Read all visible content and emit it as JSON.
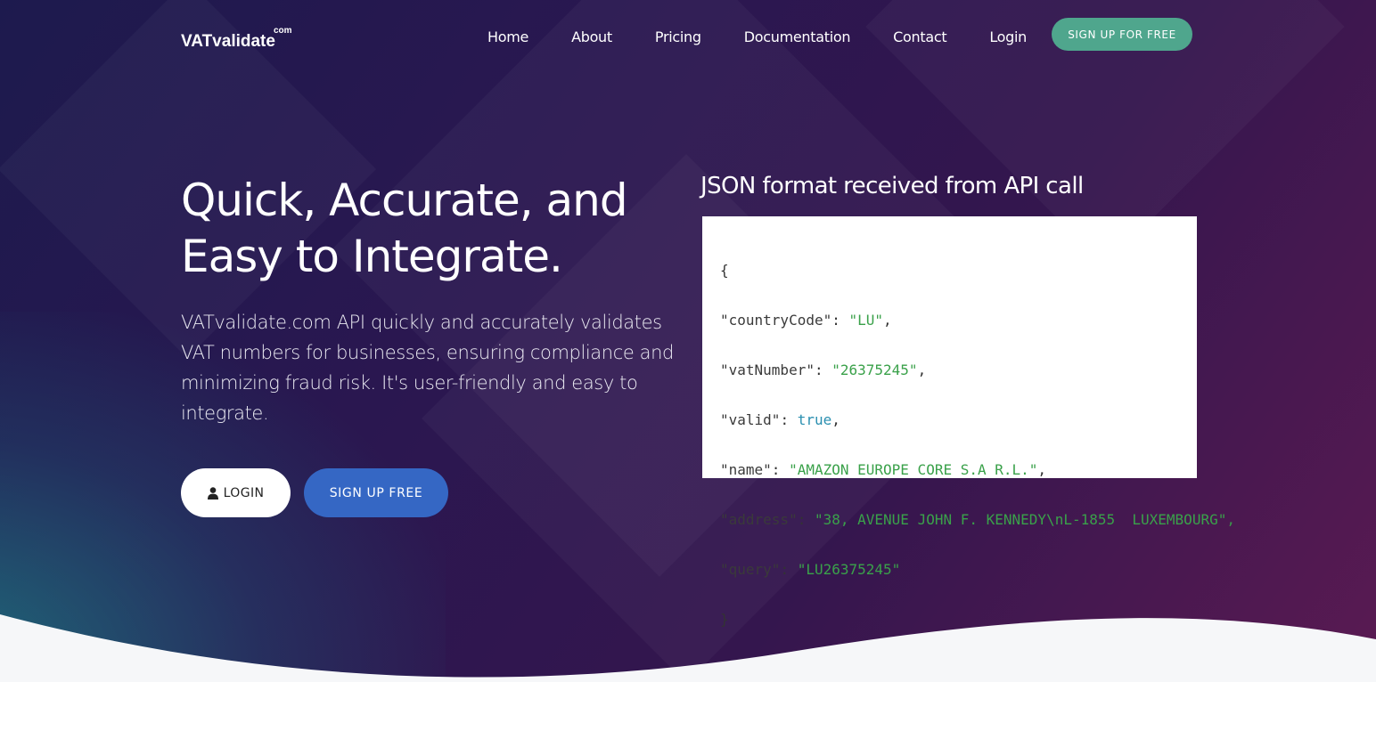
{
  "logo": {
    "name": "VATvalidate",
    "suffix": "com"
  },
  "nav": {
    "items": [
      "Home",
      "About",
      "Pricing",
      "Documentation",
      "Contact",
      "Login"
    ],
    "cta": "SIGN UP FOR FREE"
  },
  "hero": {
    "headline_line1": "Quick, Accurate, and",
    "headline_line2": "Easy to Integrate.",
    "lead": "VATvalidate.com API quickly and accurately validates VAT numbers for businesses, ensuring compliance and minimizing fraud risk. It's user-friendly and easy to integrate.",
    "login_label": "LOGIN",
    "signup_label": "SIGN UP FREE"
  },
  "json_panel": {
    "title": "JSON format received from API call",
    "open_brace": "{",
    "close_brace": "}",
    "fields": [
      {
        "key": "\"countryCode\"",
        "value": "\"LU\"",
        "type": "string",
        "comma": ","
      },
      {
        "key": "\"vatNumber\"",
        "value": "\"26375245\"",
        "type": "string",
        "comma": ","
      },
      {
        "key": "\"valid\"",
        "value": "true",
        "type": "bool",
        "comma": ","
      },
      {
        "key": "\"name\"",
        "value": "\"AMAZON EUROPE CORE S.A R.L.\"",
        "type": "string",
        "comma": ","
      },
      {
        "key": "\"address\"",
        "value": "\"38, AVENUE JOHN F. KENNEDY\\nL-1855  LUXEMBOURG\"",
        "type": "string",
        "comma": ","
      },
      {
        "key": "\"query\"",
        "value": "\"LU26375245\"",
        "type": "string",
        "comma": ""
      }
    ]
  },
  "colors": {
    "nav_cta": "#4fa68d",
    "signup_button": "#3567c4",
    "json_string": "#3aa14a",
    "json_bool": "#2a8fb0"
  }
}
